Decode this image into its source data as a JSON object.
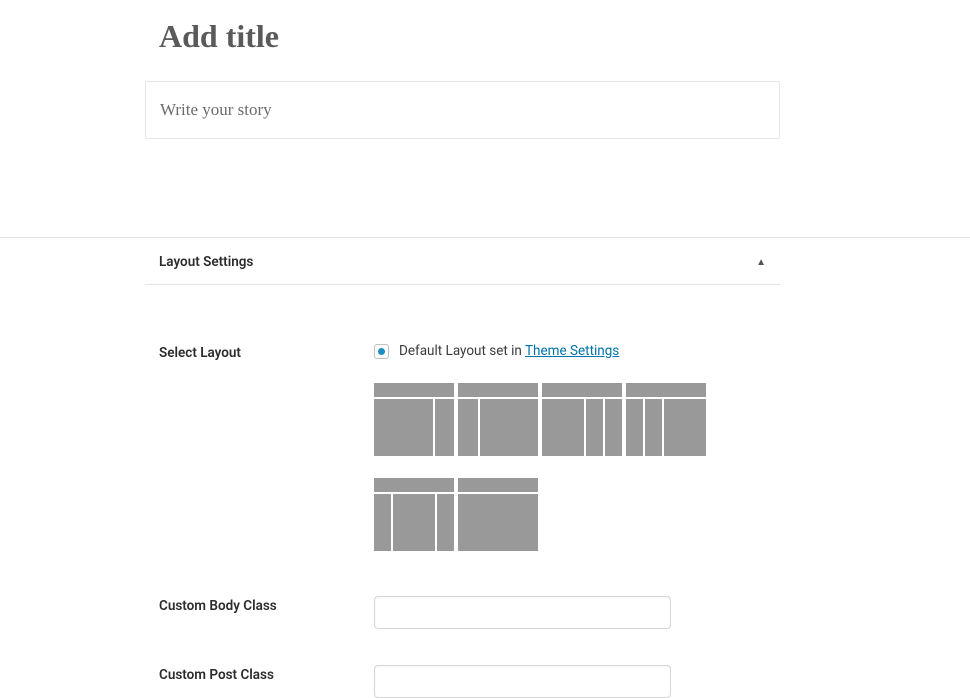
{
  "editor": {
    "title_placeholder": "Add title",
    "content_placeholder": "Write your story"
  },
  "metabox": {
    "title": "Layout Settings",
    "fields": {
      "select_layout": {
        "label": "Select Layout",
        "default_text_prefix": "Default Layout set in ",
        "default_link_text": "Theme Settings"
      },
      "body_class": {
        "label": "Custom Body Class",
        "value": ""
      },
      "post_class": {
        "label": "Custom Post Class",
        "value": ""
      }
    }
  }
}
